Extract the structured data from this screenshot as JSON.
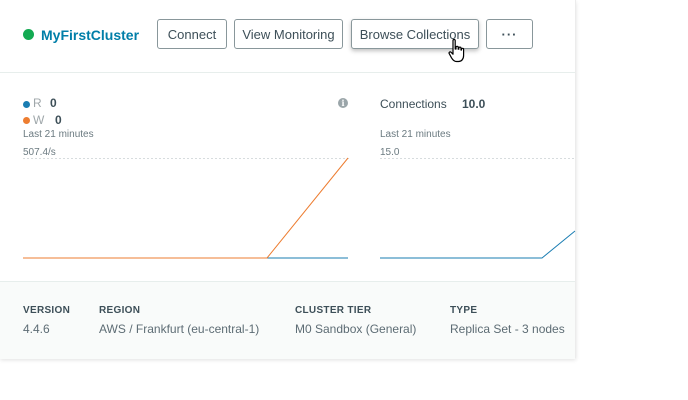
{
  "cluster": {
    "name": "MyFirstCluster",
    "status_color": "#13aa52"
  },
  "actions": {
    "connect": "Connect",
    "view_monitoring": "View Monitoring",
    "browse_collections": "Browse Collections",
    "more": "···"
  },
  "ops_metric": {
    "read_letter": "R",
    "read_value": "0",
    "read_color": "#1a7db2",
    "write_letter": "W",
    "write_value": "0",
    "write_color": "#ed7d31",
    "period": "Last 21 minutes",
    "max_label": "507.4/s",
    "info_icon": "info-icon"
  },
  "connections_metric": {
    "title": "Connections",
    "value": "10.0",
    "period": "Last 21 minutes",
    "max_label": "15.0",
    "line_color": "#1a7db2"
  },
  "details": [
    {
      "label": "VERSION",
      "value": "4.4.6"
    },
    {
      "label": "REGION",
      "value": "AWS / Frankfurt (eu-central-1)"
    },
    {
      "label": "CLUSTER TIER",
      "value": "M0 Sandbox (General)"
    },
    {
      "label": "TYPE",
      "value": "Replica Set - 3 nodes"
    }
  ]
}
